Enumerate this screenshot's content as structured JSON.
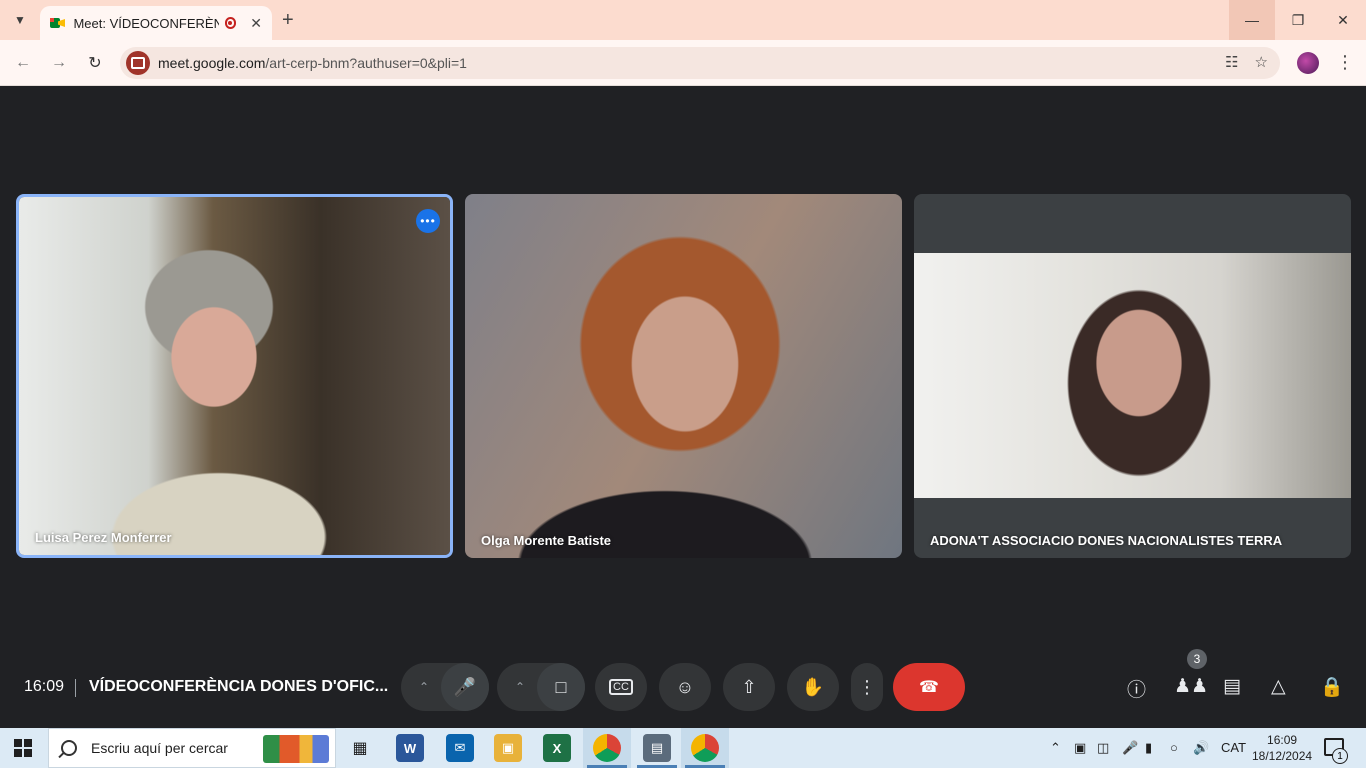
{
  "browser": {
    "tab_title": "Meet: VÍDEOCONFERÈNCIA",
    "url_host": "meet.google.com",
    "url_path": "/art-cerp-bnm?authuser=0&pli=1"
  },
  "meet": {
    "participants": [
      {
        "name": "Luisa Perez Monferrer",
        "speaking": true
      },
      {
        "name": "Olga Morente Batiste",
        "speaking": false
      },
      {
        "name": "ADONA'T ASSOCIACIO DONES NACIONALISTES TERRA",
        "speaking": false
      }
    ],
    "clock": "16:09",
    "meeting_title": "VÍDEOCONFERÈNCIA DONES D'OFIC...",
    "people_count": "3"
  },
  "taskbar": {
    "search_placeholder": "Escriu aquí per cercar",
    "language": "CAT",
    "time": "16:09",
    "date": "18/12/2024",
    "notification_count": "1"
  },
  "colors": {
    "meet_bg": "#202124",
    "active_border": "#8ab4f8",
    "hangup": "#dc362e",
    "tab_strip": "#fcdccf"
  }
}
